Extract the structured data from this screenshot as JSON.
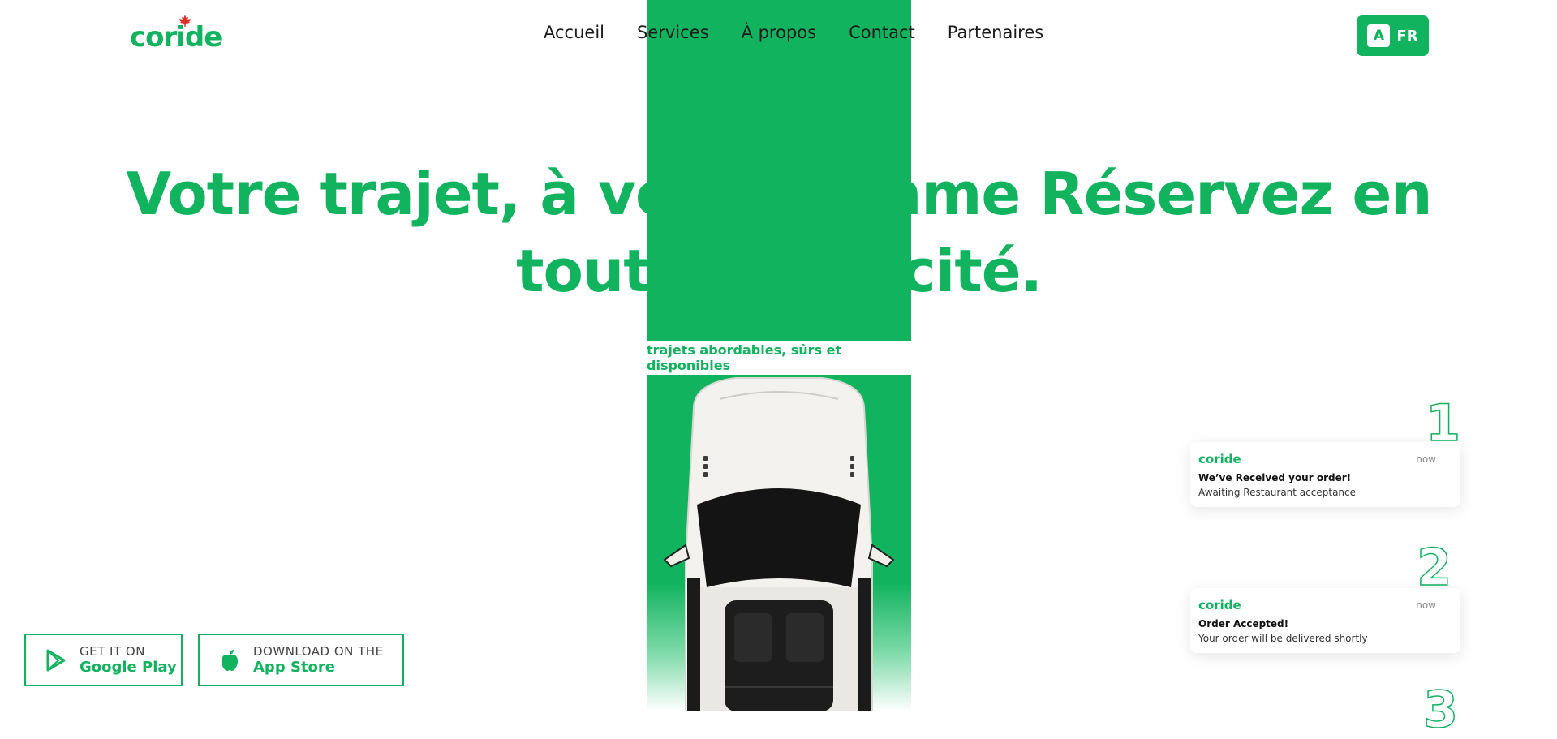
{
  "brand": {
    "logo_text": "coride",
    "color_primary": "#12b35f"
  },
  "nav": {
    "items": [
      {
        "label": "Accueil"
      },
      {
        "label": "Services"
      },
      {
        "label": "À propos"
      },
      {
        "label": "Contact"
      },
      {
        "label": "Partenaires"
      }
    ]
  },
  "language": {
    "icon_letter": "A",
    "label": "FR"
  },
  "hero": {
    "title": "Votre trajet, à votre rythme Réservez en toute simplicité.",
    "tagline": "trajets abordables, sûrs et disponibles"
  },
  "stores": {
    "google_play": {
      "small": "GET IT ON",
      "big": "Google Play",
      "icon": "play-icon"
    },
    "app_store": {
      "small": "DOWNLOAD ON THE",
      "big": "App Store",
      "icon": "apple-icon"
    }
  },
  "steps": [
    {
      "number": "1",
      "logo": "coride",
      "time": "now",
      "title": "We’ve Received your order!",
      "body": "Awaiting Restaurant acceptance"
    },
    {
      "number": "2",
      "logo": "coride",
      "time": "now",
      "title": "Order Accepted!",
      "body": "Your order will be delivered shortly"
    },
    {
      "number": "3"
    }
  ]
}
